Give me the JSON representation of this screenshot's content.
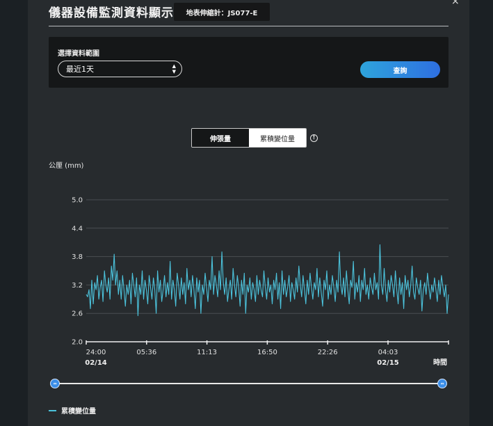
{
  "header": {
    "title": "儀器設備監測資料顯示",
    "meter_label": "地表伸縮計：JS077-E",
    "close_glyph": "×"
  },
  "query": {
    "range_label": "選擇資料範圍",
    "range_value": "最近1天",
    "submit_label": "查詢"
  },
  "toggle": {
    "options": [
      "伸張量",
      "累積變位量"
    ],
    "selected": "累積變位量"
  },
  "colors": {
    "accent": "#2e8ae0",
    "series": "#4cc3dc"
  },
  "chart_data": {
    "type": "line",
    "ylabel": "公厘 (mm)",
    "ylim": [
      2.0,
      5.0
    ],
    "yticks": [
      "2.0",
      "2.6",
      "3.2",
      "3.8",
      "4.4",
      "5.0"
    ],
    "ytick_values": [
      2.0,
      2.6,
      3.2,
      3.8,
      4.4,
      5.0
    ],
    "xticks": [
      {
        "time": "24:00",
        "date": "02/14"
      },
      {
        "time": "05:36",
        "date": ""
      },
      {
        "time": "11:13",
        "date": ""
      },
      {
        "time": "16:50",
        "date": ""
      },
      {
        "time": "22:26",
        "date": ""
      },
      {
        "time": "04:03",
        "date": "02/15"
      }
    ],
    "xaxis_end_label": "時間",
    "grid": true,
    "series": [
      {
        "name": "累積變位量",
        "values": [
          3.0,
          2.95,
          3.1,
          2.7,
          3.3,
          2.8,
          3.25,
          3.1,
          3.4,
          2.9,
          3.15,
          3.3,
          2.85,
          3.5,
          3.2,
          3.05,
          3.35,
          2.9,
          3.6,
          3.3,
          3.85,
          3.2,
          3.5,
          3.0,
          3.3,
          2.9,
          3.4,
          3.1,
          2.75,
          3.2,
          3.0,
          3.3,
          2.8,
          3.45,
          3.2,
          2.95,
          3.35,
          2.55,
          3.2,
          3.0,
          3.5,
          2.9,
          3.3,
          3.1,
          2.8,
          3.4,
          3.15,
          2.9,
          3.35,
          3.1,
          2.6,
          3.5,
          3.05,
          3.3,
          2.85,
          3.1,
          3.4,
          2.95,
          3.25,
          3.0,
          3.7,
          2.9,
          3.3,
          3.1,
          2.75,
          3.45,
          3.2,
          2.9,
          3.35,
          3.0,
          3.25,
          2.8,
          3.55,
          3.1,
          3.3,
          2.95,
          3.4,
          3.1,
          2.7,
          3.35,
          3.05,
          3.3,
          2.6,
          3.2,
          3.0,
          3.45,
          3.15,
          2.85,
          3.3,
          3.1,
          3.8,
          3.0,
          3.4,
          3.2,
          2.95,
          3.5,
          3.1,
          3.9,
          3.25,
          3.0,
          3.35,
          2.85,
          3.1,
          3.3,
          2.9,
          3.55,
          3.2,
          2.95,
          3.4,
          3.15,
          2.75,
          3.3,
          3.0,
          3.45,
          2.6,
          3.2,
          3.05,
          3.35,
          2.9,
          3.25,
          3.1,
          2.85,
          3.4,
          3.0,
          3.3,
          3.1,
          2.95,
          3.5,
          3.15,
          2.9,
          3.35,
          3.05,
          3.2,
          2.8,
          3.3,
          3.1,
          3.45,
          2.9,
          3.25,
          2.7,
          3.5,
          3.0,
          3.3,
          2.95,
          3.15,
          3.4,
          2.85,
          3.25,
          3.1,
          2.9,
          3.35,
          3.05,
          3.6,
          3.2,
          2.95,
          3.4,
          3.1,
          2.8,
          3.3,
          3.0,
          3.45,
          3.15,
          2.9,
          3.25,
          3.1,
          3.55,
          2.95,
          3.35,
          3.05,
          2.75,
          3.3,
          3.1,
          3.5,
          2.9,
          3.2,
          3.0,
          3.4,
          3.15,
          2.85,
          3.3,
          3.05,
          3.9,
          3.2,
          3.0,
          3.35,
          2.95,
          3.5,
          3.1,
          2.8,
          3.3,
          3.15,
          3.7,
          2.9,
          3.25,
          3.05,
          3.4,
          2.85,
          3.3,
          3.1,
          3.55,
          3.0,
          3.2,
          2.9,
          3.35,
          3.15,
          3.0,
          3.45,
          3.1,
          3.25,
          2.9,
          4.05,
          3.2,
          3.0,
          3.55,
          3.1,
          2.85,
          3.3,
          3.05,
          3.4,
          3.2,
          2.95,
          3.5,
          3.1,
          2.8,
          3.35,
          3.0,
          3.25,
          2.7,
          3.4,
          3.1,
          3.3,
          2.95,
          3.2,
          3.6,
          3.05,
          2.9,
          3.35,
          3.15,
          3.0,
          3.3,
          2.65,
          3.1,
          3.25,
          3.0,
          3.45,
          3.15,
          2.9,
          3.2,
          3.05,
          3.35,
          3.1,
          2.85,
          3.3,
          3.0,
          3.4,
          3.15,
          2.95,
          3.2,
          2.6,
          3.0
        ]
      }
    ]
  },
  "slider": {
    "start_icon": "⇔",
    "end_icon": "⇔"
  }
}
